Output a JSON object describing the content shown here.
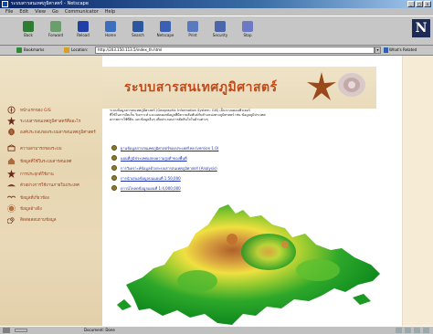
{
  "window": {
    "title": "ระบบสารสนเทศภูมิศาสตร์ - Netscape"
  },
  "menu": [
    "File",
    "Edit",
    "View",
    "Go",
    "Communicator",
    "Help"
  ],
  "toolbar": {
    "buttons": [
      {
        "label": "Back",
        "color": "#2e7d32"
      },
      {
        "label": "Forward",
        "color": "#6a9e6a"
      },
      {
        "label": "Reload",
        "color": "#1e3fa8"
      },
      {
        "label": "Home",
        "color": "#3c6ec0"
      },
      {
        "label": "Search",
        "color": "#2b56a0"
      },
      {
        "label": "Netscape",
        "color": "#3a5fb5"
      },
      {
        "label": "Print",
        "color": "#5a7abf"
      },
      {
        "label": "Security",
        "color": "#4b66aa"
      },
      {
        "label": "Stop",
        "color": "#6d79c4"
      }
    ],
    "logo": "N"
  },
  "location": {
    "bookmarks_label": "Bookmarks",
    "location_label": "Location:",
    "url": "http://203.150.113.5/index_th.html",
    "related_label": "What's Related"
  },
  "sidebar": {
    "items": [
      {
        "label": "หน้าแรกของ GIS",
        "icon": "compass-icon",
        "color": "#7a3b20"
      },
      {
        "label": "ระบบสารสนเทศภูมิศาสตร์คืออะไร",
        "icon": "star-icon",
        "color": "#6a2a18"
      },
      {
        "label": "องค์ประกอบของระบบสารสนเทศภูมิศาสตร์",
        "icon": "globe-icon",
        "color": "#8a4a20"
      },
      {
        "label": "ความสามารถของระบบ",
        "icon": "box-icon",
        "color": "#7a3b20"
      },
      {
        "label": "ข้อมูลที่ใช้ในระบบสารสนเทศ",
        "icon": "house-icon",
        "color": "#8a4a20"
      },
      {
        "label": "การประยุกต์ใช้งาน",
        "icon": "star-icon",
        "color": "#6a2a18"
      },
      {
        "label": "ตัวอย่างการใช้งานภายในประเทศ",
        "icon": "hat-icon",
        "color": "#7a3b20"
      },
      {
        "label": "ข้อมูลที่เกี่ยวข้อง",
        "icon": "bird-icon",
        "color": "#8a4a20"
      },
      {
        "label": "ข้อมูลอ้างอิง",
        "icon": "sun-icon",
        "color": "#7a3b20"
      },
      {
        "label": "ติดต่อสอบถามข้อมูล",
        "icon": "spiral-icon",
        "color": "#6a2a18"
      }
    ]
  },
  "banner": {
    "title": "ระบบสารสนเทศภูมิศาสตร์"
  },
  "intro": [
    "ระบบข้อมูลสารสนเทศภูมิศาสตร์ (Geographic Information System: GIS) เป็นระบบคอมพิวเตอร์",
    "ที่ใช้ในการจัดเก็บ วิเคราะห์ และแสดงผลข้อมูลที่มีความสัมพันธ์กับตำแหน่งทางภูมิศาสตร์ เช่น ข้อมูลภูมิประเทศ",
    "สภาพการใช้ที่ดิน และข้อมูลอื่นๆ เพื่อประกอบการตัดสินใจในด้านต่างๆ"
  ],
  "links": [
    "ฐานข้อมูลสารสนเทศภูมิศาสตร์ของประเทศไทย (version 1.0)",
    "แผนที่ภูมิประเทศแสดงความสูงต่ำของพื้นที่",
    "การวิเคราะห์ข้อมูลด้วยระบบสารสนเทศภูมิศาสตร์ (Analysis)",
    "การนำเสนอข้อมูลบนแผนที่ 1:50,000",
    "ดาวน์โหลดข้อมูลแผนที่ 1:4,000,000"
  ],
  "status": {
    "text": "Document: Done"
  },
  "colors": {
    "accent": "#c04a1a",
    "link": "#1a2fb0"
  }
}
